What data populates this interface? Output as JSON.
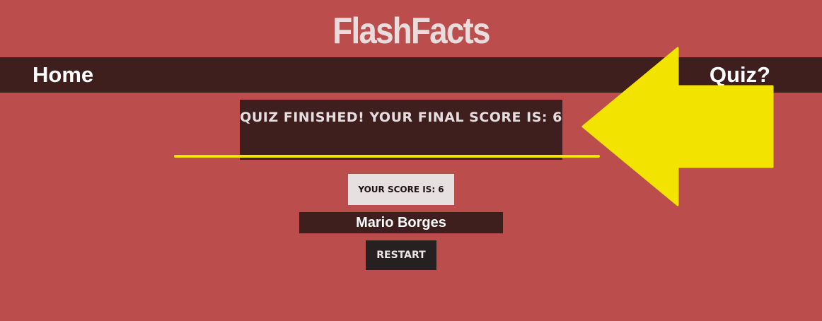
{
  "site": {
    "title": "FlashFacts"
  },
  "nav": {
    "home_label": "Home",
    "quiz_label": "Quiz?"
  },
  "result": {
    "final_message": "QUIZ FINISHED! YOUR FINAL SCORE IS: 6",
    "score_label": "YOUR SCORE IS: 6",
    "player_name": "Mario Borges",
    "restart_label": "RESTART"
  },
  "annotation": {
    "color": "#f3e400",
    "shapes": [
      "arrow-left",
      "underline"
    ]
  },
  "colors": {
    "background": "#bb4e4d",
    "dark_panel": "#3f1e1e",
    "button": "#262020",
    "chip": "#e6e0e0"
  }
}
